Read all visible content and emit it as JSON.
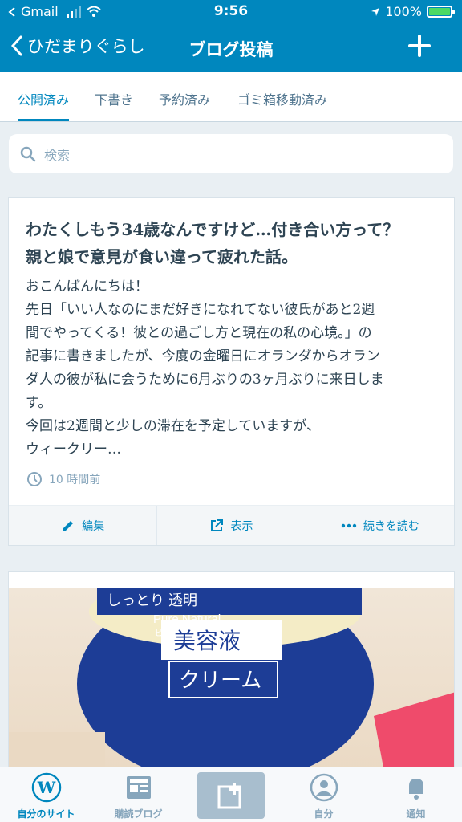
{
  "status_bar": {
    "carrier": "Gmail",
    "time": "9:56",
    "battery": "100%"
  },
  "nav": {
    "back_label": "ひだまりぐらし",
    "title": "ブログ投稿"
  },
  "tabs": [
    {
      "label": "公開済み",
      "active": true
    },
    {
      "label": "下書き",
      "active": false
    },
    {
      "label": "予約済み",
      "active": false
    },
    {
      "label": "ゴミ箱移動済み",
      "active": false
    }
  ],
  "search": {
    "placeholder": "検索"
  },
  "post": {
    "title_lines": [
      "わたくしもう34歳なんですけど…付き合い方って？",
      "親と娘で意見が食い違って疲れた話。"
    ],
    "excerpt_lines": [
      "おこんばんにちは！",
      "先日「いい人なのにまだ好きになれてない彼氏があと2週",
      "間でやってくる！彼との過ごし方と現在の私の心境。」の",
      "記事に書きましたが、今度の金曜日にオランダからオラン",
      "ダ人の彼が私に会うために6月ぶりの3ヶ月ぶりに来日しま",
      "す。",
      "今回は2週間と少しの滞在を予定していますが、",
      "ウィークリー…"
    ],
    "time_ago": "10 時間前",
    "actions": {
      "edit": "編集",
      "view": "表示",
      "more": "続きを読む"
    }
  },
  "post2": {
    "image_text": {
      "line1": "しっとり 透明",
      "brand": "Pure Natural",
      "brand_kana": "ピュアナチュラル",
      "product1": "美容液",
      "product2": "クリーム"
    }
  },
  "tabbar": [
    {
      "label": "自分のサイト",
      "icon": "wordpress-icon",
      "active": true
    },
    {
      "label": "購読ブログ",
      "icon": "reader-icon",
      "active": false
    },
    {
      "label": "",
      "icon": "new-post-icon",
      "active": false
    },
    {
      "label": "自分",
      "icon": "profile-icon",
      "active": false
    },
    {
      "label": "通知",
      "icon": "bell-icon",
      "active": false
    }
  ],
  "colors": {
    "accent": "#0087be",
    "text": "#2e4453",
    "muted": "#87a6bc"
  }
}
